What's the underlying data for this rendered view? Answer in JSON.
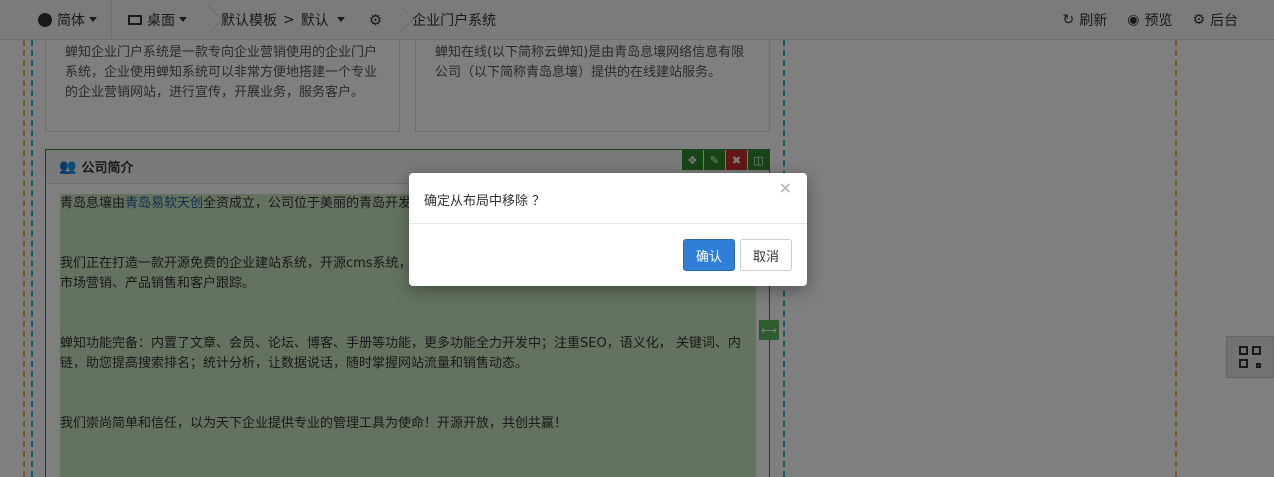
{
  "topbar": {
    "language": "简体",
    "device": "桌面",
    "template": "默认模板",
    "breadcrumb_sep": ">",
    "template_variant": "默认",
    "page": "企业门户系统",
    "refresh": "刷新",
    "preview": "预览",
    "backend": "后台"
  },
  "cards": [
    {
      "text": "蝉知企业门户系统是一款专向企业营销使用的企业门户系统，企业使用蝉知系统可以非常方便地搭建一个专业的企业营销网站，进行宣传，开展业务，服务客户。"
    },
    {
      "text": "蝉知在线(以下简称云蝉知)是由青岛息壤网络信息有限公司（以下简称青岛息壤）提供的在线建站服务。"
    }
  ],
  "panel": {
    "title": "公司简介",
    "p1_pre": "青岛息壤由",
    "p1_link": "青岛易软天创",
    "p1_post": "全资成立，公司位于美丽的青岛开发",
    "p2_line1": "我们正在打造一款开源免费的企业建站系统，开源cms系统，",
    "p2_line2": "市场营销、产品销售和客户跟踪。",
    "p3": "蝉知功能完备：内置了文章、会员、论坛、博客、手册等功能，更多功能全力开发中；注重SEO，语义化， 关键词、内链，助您提高搜索排名；统计分析，让数据说话，随时掌握网站流量和销售动态。",
    "p4": "我们崇尚简单和信任，以为天下企业提供专业的管理工具为使命！开源开放，共创共赢！"
  },
  "dialog": {
    "message": "确定从布局中移除 ？",
    "close": "×",
    "confirm": "确认",
    "cancel": "取消"
  },
  "icons": {
    "globe": "globe-icon",
    "desktop": "desktop-icon",
    "gear": "gear-icon",
    "refresh": "refresh-icon",
    "eye": "eye-icon",
    "cogs": "cogs-icon",
    "users": "users-icon",
    "move": "move-icon",
    "edit": "pencil-icon",
    "remove": "x-icon",
    "columns": "columns-icon",
    "resize": "resize-horizontal-icon",
    "qrcode": "qrcode-icon"
  },
  "colors": {
    "primary": "#2f7fd9",
    "panel_border": "#2e8b2e",
    "highlight": "#c9e7c0",
    "guide_orange": "#f0ad4e",
    "guide_blue": "#31b0d5"
  }
}
